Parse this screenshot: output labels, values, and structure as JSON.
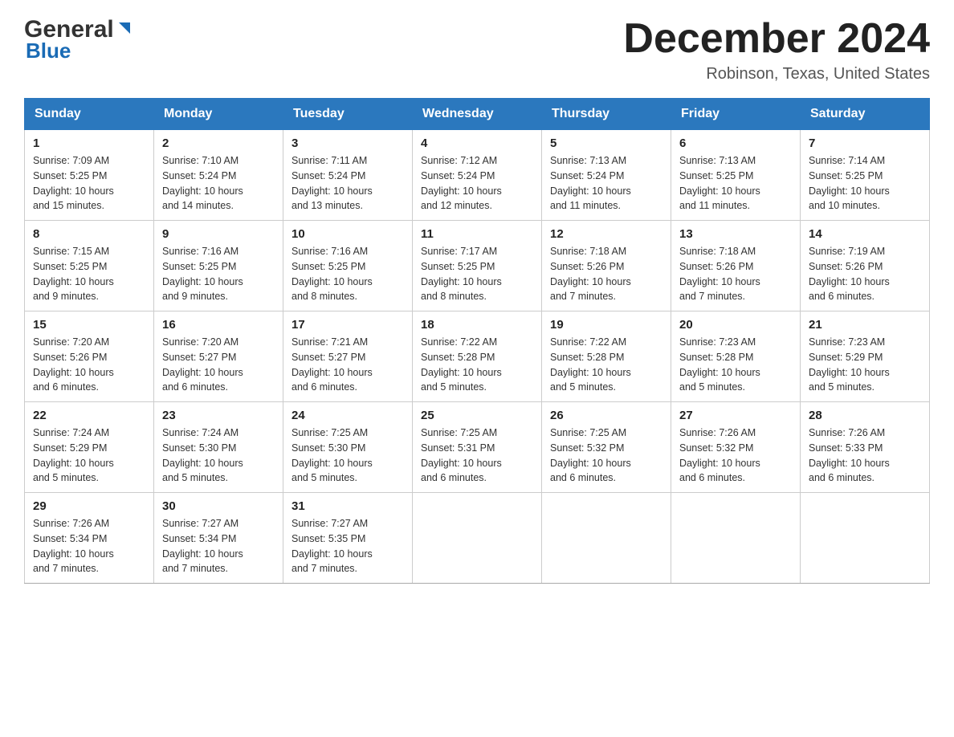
{
  "header": {
    "title": "December 2024",
    "location": "Robinson, Texas, United States",
    "logo_general": "General",
    "logo_blue": "Blue"
  },
  "days_of_week": [
    "Sunday",
    "Monday",
    "Tuesday",
    "Wednesday",
    "Thursday",
    "Friday",
    "Saturday"
  ],
  "weeks": [
    [
      {
        "day": "1",
        "sunrise": "7:09 AM",
        "sunset": "5:25 PM",
        "daylight": "10 hours and 15 minutes."
      },
      {
        "day": "2",
        "sunrise": "7:10 AM",
        "sunset": "5:24 PM",
        "daylight": "10 hours and 14 minutes."
      },
      {
        "day": "3",
        "sunrise": "7:11 AM",
        "sunset": "5:24 PM",
        "daylight": "10 hours and 13 minutes."
      },
      {
        "day": "4",
        "sunrise": "7:12 AM",
        "sunset": "5:24 PM",
        "daylight": "10 hours and 12 minutes."
      },
      {
        "day": "5",
        "sunrise": "7:13 AM",
        "sunset": "5:24 PM",
        "daylight": "10 hours and 11 minutes."
      },
      {
        "day": "6",
        "sunrise": "7:13 AM",
        "sunset": "5:25 PM",
        "daylight": "10 hours and 11 minutes."
      },
      {
        "day": "7",
        "sunrise": "7:14 AM",
        "sunset": "5:25 PM",
        "daylight": "10 hours and 10 minutes."
      }
    ],
    [
      {
        "day": "8",
        "sunrise": "7:15 AM",
        "sunset": "5:25 PM",
        "daylight": "10 hours and 9 minutes."
      },
      {
        "day": "9",
        "sunrise": "7:16 AM",
        "sunset": "5:25 PM",
        "daylight": "10 hours and 9 minutes."
      },
      {
        "day": "10",
        "sunrise": "7:16 AM",
        "sunset": "5:25 PM",
        "daylight": "10 hours and 8 minutes."
      },
      {
        "day": "11",
        "sunrise": "7:17 AM",
        "sunset": "5:25 PM",
        "daylight": "10 hours and 8 minutes."
      },
      {
        "day": "12",
        "sunrise": "7:18 AM",
        "sunset": "5:26 PM",
        "daylight": "10 hours and 7 minutes."
      },
      {
        "day": "13",
        "sunrise": "7:18 AM",
        "sunset": "5:26 PM",
        "daylight": "10 hours and 7 minutes."
      },
      {
        "day": "14",
        "sunrise": "7:19 AM",
        "sunset": "5:26 PM",
        "daylight": "10 hours and 6 minutes."
      }
    ],
    [
      {
        "day": "15",
        "sunrise": "7:20 AM",
        "sunset": "5:26 PM",
        "daylight": "10 hours and 6 minutes."
      },
      {
        "day": "16",
        "sunrise": "7:20 AM",
        "sunset": "5:27 PM",
        "daylight": "10 hours and 6 minutes."
      },
      {
        "day": "17",
        "sunrise": "7:21 AM",
        "sunset": "5:27 PM",
        "daylight": "10 hours and 6 minutes."
      },
      {
        "day": "18",
        "sunrise": "7:22 AM",
        "sunset": "5:28 PM",
        "daylight": "10 hours and 5 minutes."
      },
      {
        "day": "19",
        "sunrise": "7:22 AM",
        "sunset": "5:28 PM",
        "daylight": "10 hours and 5 minutes."
      },
      {
        "day": "20",
        "sunrise": "7:23 AM",
        "sunset": "5:28 PM",
        "daylight": "10 hours and 5 minutes."
      },
      {
        "day": "21",
        "sunrise": "7:23 AM",
        "sunset": "5:29 PM",
        "daylight": "10 hours and 5 minutes."
      }
    ],
    [
      {
        "day": "22",
        "sunrise": "7:24 AM",
        "sunset": "5:29 PM",
        "daylight": "10 hours and 5 minutes."
      },
      {
        "day": "23",
        "sunrise": "7:24 AM",
        "sunset": "5:30 PM",
        "daylight": "10 hours and 5 minutes."
      },
      {
        "day": "24",
        "sunrise": "7:25 AM",
        "sunset": "5:30 PM",
        "daylight": "10 hours and 5 minutes."
      },
      {
        "day": "25",
        "sunrise": "7:25 AM",
        "sunset": "5:31 PM",
        "daylight": "10 hours and 6 minutes."
      },
      {
        "day": "26",
        "sunrise": "7:25 AM",
        "sunset": "5:32 PM",
        "daylight": "10 hours and 6 minutes."
      },
      {
        "day": "27",
        "sunrise": "7:26 AM",
        "sunset": "5:32 PM",
        "daylight": "10 hours and 6 minutes."
      },
      {
        "day": "28",
        "sunrise": "7:26 AM",
        "sunset": "5:33 PM",
        "daylight": "10 hours and 6 minutes."
      }
    ],
    [
      {
        "day": "29",
        "sunrise": "7:26 AM",
        "sunset": "5:34 PM",
        "daylight": "10 hours and 7 minutes."
      },
      {
        "day": "30",
        "sunrise": "7:27 AM",
        "sunset": "5:34 PM",
        "daylight": "10 hours and 7 minutes."
      },
      {
        "day": "31",
        "sunrise": "7:27 AM",
        "sunset": "5:35 PM",
        "daylight": "10 hours and 7 minutes."
      },
      null,
      null,
      null,
      null
    ]
  ],
  "labels": {
    "sunrise": "Sunrise:",
    "sunset": "Sunset:",
    "daylight": "Daylight:"
  }
}
